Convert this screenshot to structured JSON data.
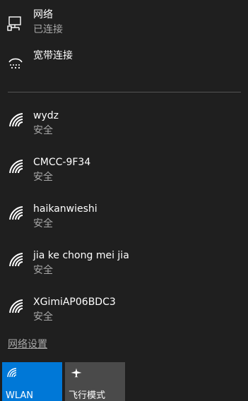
{
  "wired": {
    "network": {
      "name": "网络",
      "status": "已连接"
    },
    "broadband": {
      "name": "宽带连接"
    }
  },
  "wifi_networks": [
    {
      "name": "wydz",
      "security": "安全"
    },
    {
      "name": "CMCC-9F34",
      "security": "安全"
    },
    {
      "name": "haikanwieshi",
      "security": "安全"
    },
    {
      "name": "jia ke chong mei jia",
      "security": "安全"
    },
    {
      "name": "XGimiAP06BDC3",
      "security": "安全"
    }
  ],
  "settings_link": "网络设置",
  "tiles": {
    "wlan": {
      "label": "WLAN",
      "icon": "wifi-icon"
    },
    "airplane": {
      "label": "飞行模式",
      "icon": "airplane-icon"
    }
  },
  "colors": {
    "background": "#1f1f1f",
    "accent": "#0078d7",
    "tile_inactive": "#4a4a4a",
    "secondary_text": "#a8a8a8"
  }
}
